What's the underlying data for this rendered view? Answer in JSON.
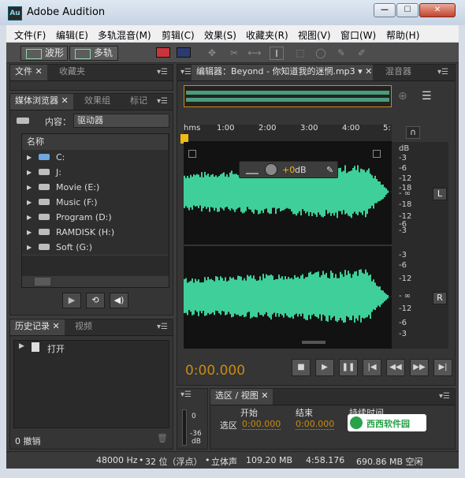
{
  "window": {
    "title": "Adobe Audition",
    "app_icon_text": "Au",
    "minimize": "—",
    "maximize": "☐",
    "close": "✕"
  },
  "menu": [
    "文件(F)",
    "编辑(E)",
    "多轨混音(M)",
    "剪辑(C)",
    "效果(S)",
    "收藏夹(R)",
    "视图(V)",
    "窗口(W)",
    "帮助(H)"
  ],
  "toolbar": {
    "waveform_label": "波形",
    "multitrack_label": "多轨"
  },
  "files_panel": {
    "tabs": [
      "文件",
      "收藏夹"
    ]
  },
  "media_browser": {
    "tabs": [
      "媒体浏览器",
      "效果组",
      "标记"
    ],
    "content_label": "内容：",
    "content_value": "驱动器",
    "column_header": "名称",
    "drives": [
      "C:",
      "J:",
      "Movie (E:)",
      "Music (F:)",
      "Program (D:)",
      "RAMDISK (H:)",
      "Soft (G:)"
    ]
  },
  "history_panel": {
    "tabs": [
      "历史记录",
      "视频"
    ],
    "items": [
      "打开"
    ],
    "undo_count": "0 撤销"
  },
  "editor": {
    "tab_label": "编辑器：Beyond - 你知道我的迷惘.mp3",
    "mixer_tab": "混音器",
    "ruler_unit": "hms",
    "ruler_ticks": [
      "1:00",
      "2:00",
      "3:00",
      "4:00",
      "5:"
    ],
    "db_scale_top": [
      "dB",
      "-3",
      "-6",
      "-12",
      "-18",
      "- ∞",
      "-18",
      "-12",
      "-6",
      "-3"
    ],
    "db_scale_bottom": [
      "-3",
      "-6",
      "-12",
      "- ∞",
      "-12",
      "-6",
      "-3"
    ],
    "channel_left": "L",
    "channel_right": "R",
    "hud_gain": "+0",
    "hud_unit": "dB",
    "time_display": "0:00.000",
    "wave_color": "#3fcf9a"
  },
  "level_meter": {
    "scale": [
      "0",
      "-36",
      "dB"
    ]
  },
  "selection_panel": {
    "tab": "选区 / 视图",
    "col_start": "开始",
    "col_end": "结束",
    "col_duration": "持续时间",
    "row_label": "选区",
    "start_value": "0:00.000",
    "end_value": "0:00.000",
    "watermark_text": "西西软件园"
  },
  "status": {
    "sample_rate": "48000 Hz",
    "bit_depth": "32 位（浮点）",
    "channels": "立体声",
    "file_size": "109.20 MB",
    "duration": "4:58.176",
    "free_space": "690.86 MB 空闲"
  }
}
